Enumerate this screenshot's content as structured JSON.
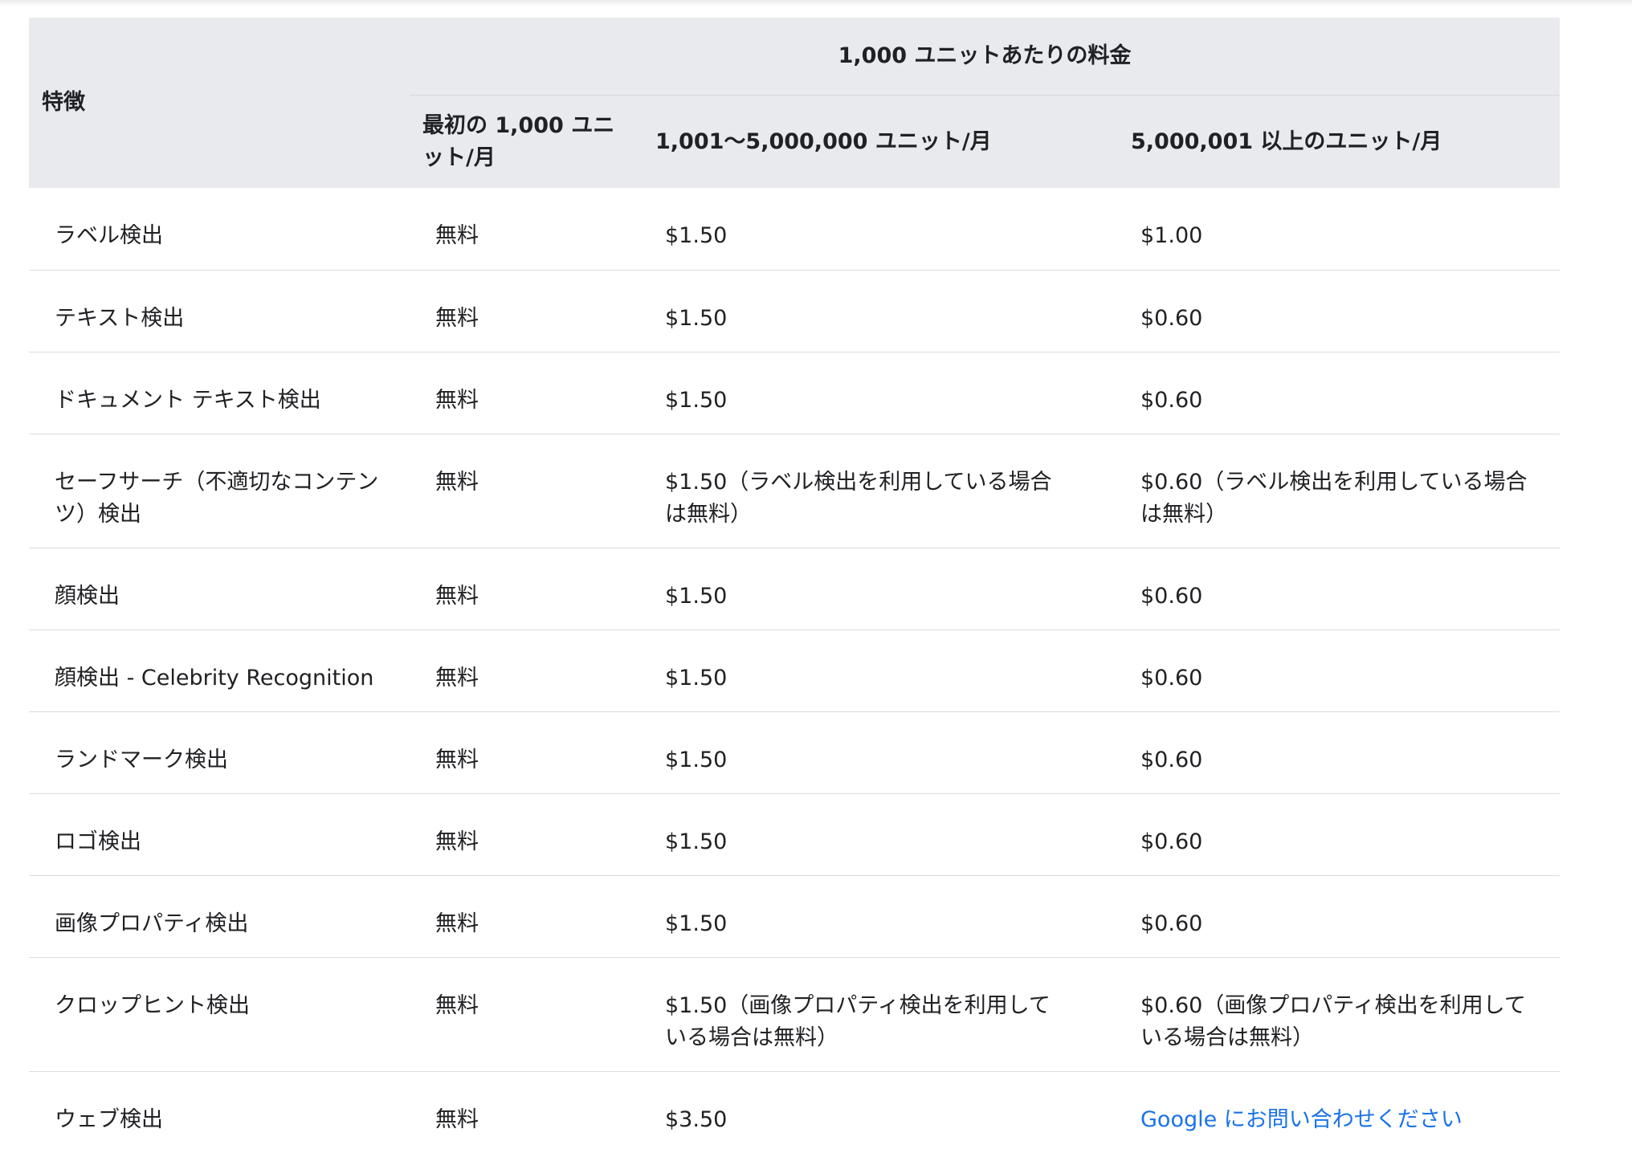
{
  "table": {
    "header": {
      "feature": "特徴",
      "group": "1,000 ユニットあたりの料金",
      "tiers": [
        "最初の 1,000 ユニット/月",
        "1,001〜5,000,000 ユニット/月",
        "5,000,001 以上のユニット/月"
      ]
    },
    "rows": [
      {
        "feature": "ラベル検出",
        "free": "無料",
        "tier2": "$1.50",
        "tier3": "$1.00"
      },
      {
        "feature": "テキスト検出",
        "free": "無料",
        "tier2": "$1.50",
        "tier3": "$0.60"
      },
      {
        "feature": "ドキュメント テキスト検出",
        "free": "無料",
        "tier2": "$1.50",
        "tier3": "$0.60"
      },
      {
        "feature": "セーフサーチ（不適切なコンテンツ）検出",
        "free": "無料",
        "tier2": "$1.50（ラベル検出を利用している場合は無料）",
        "tier3": "$0.60（ラベル検出を利用している場合は無料）"
      },
      {
        "feature": "顔検出",
        "free": "無料",
        "tier2": "$1.50",
        "tier3": "$0.60"
      },
      {
        "feature": "顔検出 - Celebrity Recognition",
        "free": "無料",
        "tier2": "$1.50",
        "tier3": "$0.60"
      },
      {
        "feature": "ランドマーク検出",
        "free": "無料",
        "tier2": "$1.50",
        "tier3": "$0.60"
      },
      {
        "feature": "ロゴ検出",
        "free": "無料",
        "tier2": "$1.50",
        "tier3": "$0.60"
      },
      {
        "feature": "画像プロパティ検出",
        "free": "無料",
        "tier2": "$1.50",
        "tier3": "$0.60"
      },
      {
        "feature": "クロップヒント検出",
        "free": "無料",
        "tier2": "$1.50（画像プロパティ検出を利用している場合は無料）",
        "tier3": "$0.60（画像プロパティ検出を利用している場合は無料）"
      },
      {
        "feature": "ウェブ検出",
        "free": "無料",
        "tier2": "$3.50",
        "tier3": "Google にお問い合わせください"
      }
    ]
  },
  "colors": {
    "header_bg": "#e8eaed",
    "link": "#1a73e8",
    "text": "#202124",
    "divider": "#dadce0"
  }
}
